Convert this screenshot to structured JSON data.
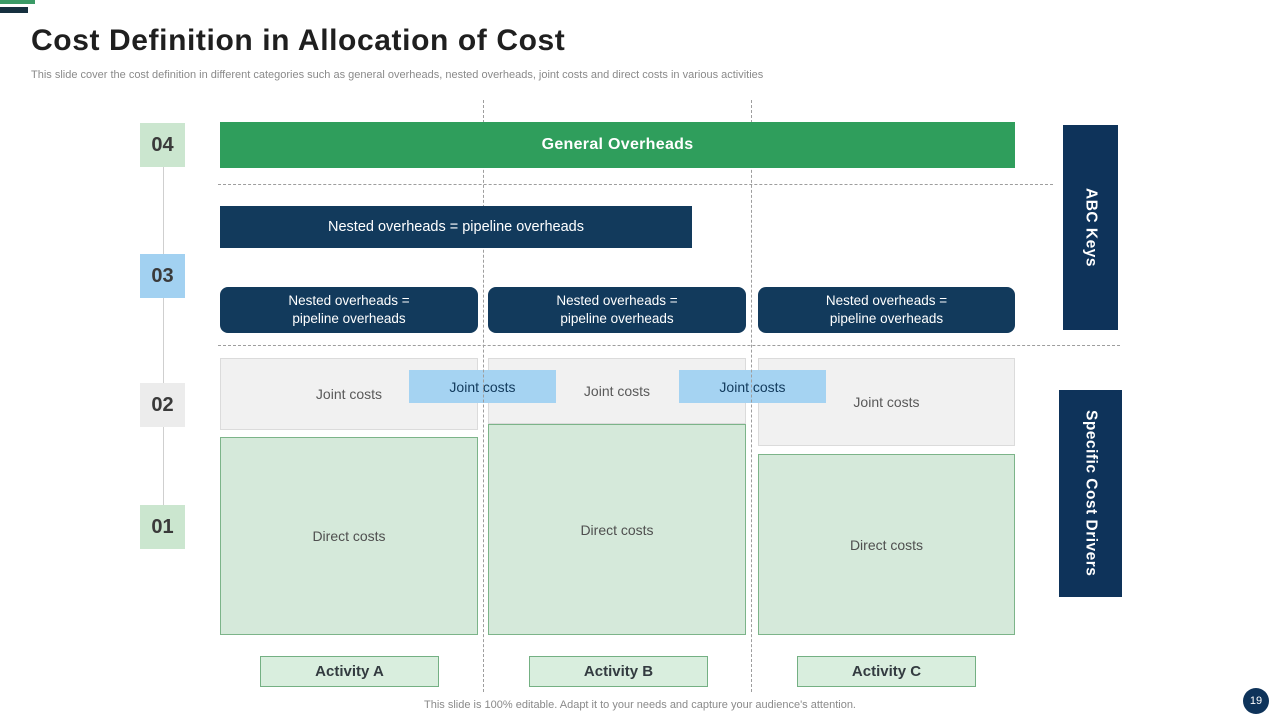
{
  "theme": {
    "green": "#2F9E5C",
    "navy": "#123A5C",
    "sidebar-navy": "#0E335A",
    "accent-green": "#3A9A66",
    "accent-navy": "#16303F",
    "light-blue": "#A5D3F2",
    "pale-green": "#D5E9DA",
    "green-border": "#7CB489",
    "pale-gray": "#F1F1F1",
    "timeline-green": "#CBE6CF",
    "timeline-blue": "#A2D1F1",
    "timeline-gray": "#ECECEC",
    "text-dark": "#1F1F1F",
    "text-mid": "#595959",
    "text-gray": "#8A8A8A"
  },
  "header": {
    "title": "Cost Definition in Allocation of Cost",
    "subtitle": "This slide cover the cost definition in different categories such as general overheads, nested overheads, joint costs and direct costs in various activities"
  },
  "timeline": {
    "items": [
      {
        "label": "04"
      },
      {
        "label": "03"
      },
      {
        "label": "02"
      },
      {
        "label": "01"
      }
    ]
  },
  "diagram": {
    "general_overheads": "General Overheads",
    "nested_wide": "Nested overheads = pipeline overheads",
    "nested_line1": "Nested overheads =",
    "nested_line2": "pipeline overheads",
    "joint_costs": "Joint costs",
    "direct_costs": "Direct costs",
    "activities": [
      {
        "label": "Activity A"
      },
      {
        "label": "Activity B"
      },
      {
        "label": "Activity C"
      }
    ]
  },
  "sidebars": {
    "abc_keys": "ABC Keys",
    "specific_cost_drivers": "Specific Cost Drivers"
  },
  "footer": {
    "note": "This slide is 100% editable. Adapt it to your needs and capture your audience's attention.",
    "page_number": "19"
  }
}
